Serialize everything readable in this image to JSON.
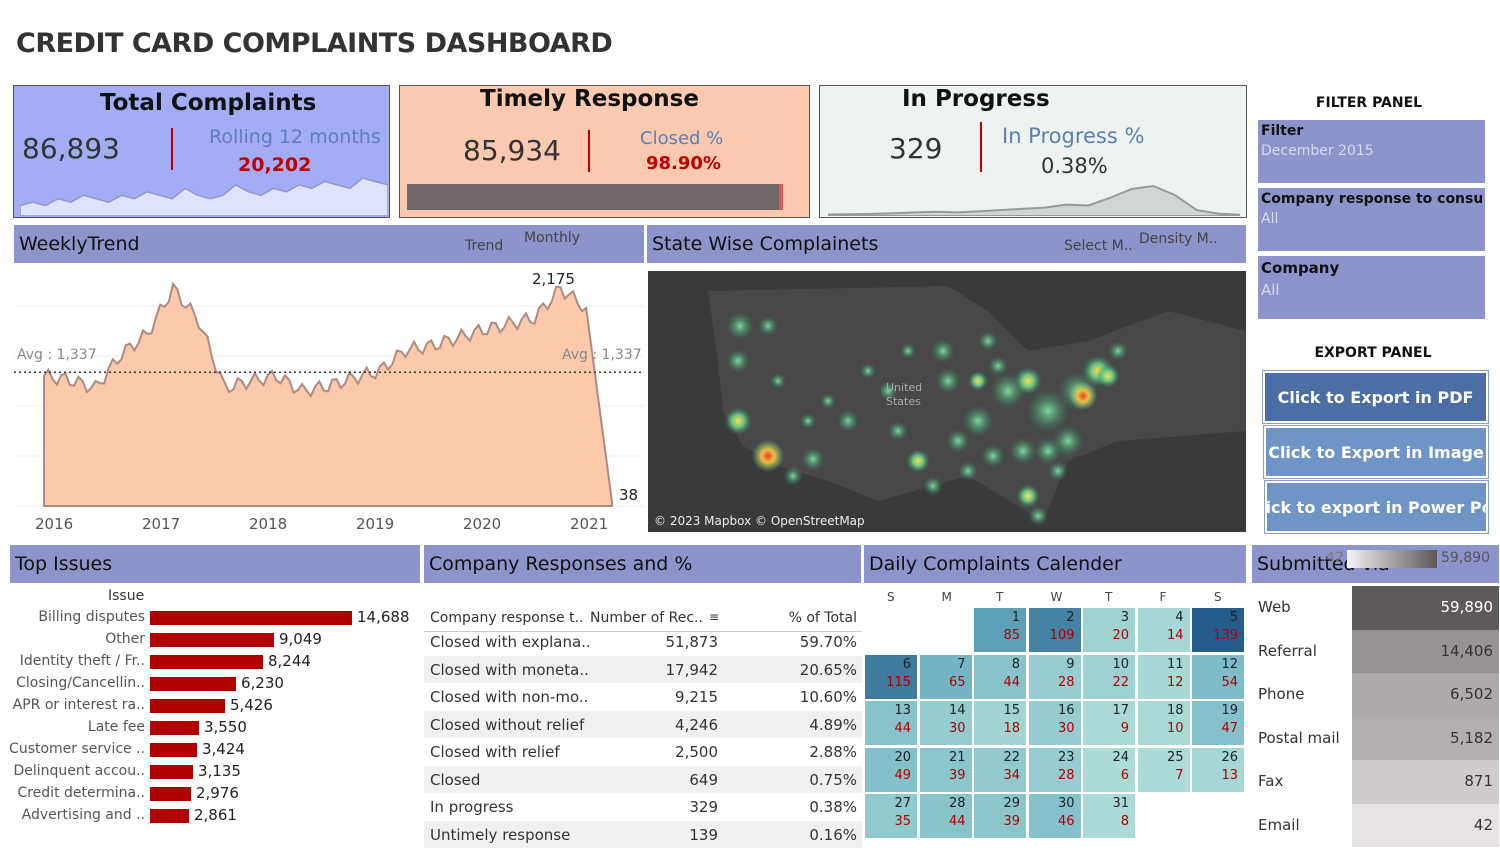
{
  "title": "CREDIT CARD COMPLAINTS DASHBOARD",
  "kpi": {
    "total": {
      "title": "Total Complaints",
      "value": "86,893",
      "sub_label": "Rolling 12 months",
      "sub_value": "20,202"
    },
    "timely": {
      "title": "Timely Response",
      "value": "85,934",
      "sub_label": "Closed %",
      "sub_value": "98.90%",
      "bar_fraction": 0.989
    },
    "progress": {
      "title": "In Progress",
      "value": "329",
      "sub_label": "In Progress %",
      "sub_value": "0.38%"
    }
  },
  "weekly": {
    "header": "WeeklyTrend",
    "trend_label": "Trend",
    "trend_value": "Monthly",
    "avg_left": "Avg : 1,337",
    "avg_right": "Avg : 1,337",
    "peak_label": "2,175",
    "end_label": "38",
    "years": [
      "2016",
      "2017",
      "2018",
      "2019",
      "2020",
      "2021"
    ]
  },
  "state": {
    "header": "State Wise Complainets",
    "select_label": "Select M..",
    "select_value": "Density M..",
    "map_label_1": "United",
    "map_label_2": "States",
    "attribution": "© 2023 Mapbox © OpenStreetMap"
  },
  "filter_panel": {
    "title": "FILTER PANEL",
    "filters": [
      {
        "label": "Filter",
        "value": "December 2015"
      },
      {
        "label": "Company response to consumer",
        "value": "All"
      },
      {
        "label": "Company",
        "value": "All"
      }
    ]
  },
  "export_panel": {
    "title": "EXPORT PANEL",
    "buttons": [
      "Click to Export in PDF",
      "Click to Export in Image",
      "Click to export in Power Po.."
    ]
  },
  "top_issues": {
    "header": "Top Issues",
    "column": "Issue",
    "items": [
      {
        "label": "Billing disputes",
        "value": "14,688",
        "n": 14688
      },
      {
        "label": "Other",
        "value": "9,049",
        "n": 9049
      },
      {
        "label": "Identity theft / Fr..",
        "value": "8,244",
        "n": 8244
      },
      {
        "label": "Closing/Cancellin..",
        "value": "6,230",
        "n": 6230
      },
      {
        "label": "APR or interest ra..",
        "value": "5,426",
        "n": 5426
      },
      {
        "label": "Late fee",
        "value": "3,550",
        "n": 3550
      },
      {
        "label": "Customer service ..",
        "value": "3,424",
        "n": 3424
      },
      {
        "label": "Delinquent accou..",
        "value": "3,135",
        "n": 3135
      },
      {
        "label": "Credit determina..",
        "value": "2,976",
        "n": 2976
      },
      {
        "label": "Advertising and ..",
        "value": "2,861",
        "n": 2861
      }
    ]
  },
  "responses": {
    "header": "Company Responses and %",
    "columns": [
      "Company response t..",
      "Number of Rec..",
      "% of Total"
    ],
    "rows": [
      [
        "Closed with explana..",
        "51,873",
        "59.70%"
      ],
      [
        "Closed with moneta..",
        "17,942",
        "20.65%"
      ],
      [
        "Closed with non-mo..",
        "9,215",
        "10.60%"
      ],
      [
        "Closed without relief",
        "4,246",
        "4.89%"
      ],
      [
        "Closed with relief",
        "2,500",
        "2.88%"
      ],
      [
        "Closed",
        "649",
        "0.75%"
      ],
      [
        "In progress",
        "329",
        "0.38%"
      ],
      [
        "Untimely response",
        "139",
        "0.16%"
      ]
    ]
  },
  "calendar": {
    "header": "Daily Complaints Calender",
    "weekdays": [
      "S",
      "M",
      "T",
      "W",
      "T",
      "F",
      "S"
    ],
    "first_weekday": 2,
    "days": [
      {
        "d": "1",
        "c": "85",
        "n": 85
      },
      {
        "d": "2",
        "c": "109",
        "n": 109
      },
      {
        "d": "3",
        "c": "20",
        "n": 20
      },
      {
        "d": "4",
        "c": "14",
        "n": 14
      },
      {
        "d": "5",
        "c": "139",
        "n": 139
      },
      {
        "d": "6",
        "c": "115",
        "n": 115
      },
      {
        "d": "7",
        "c": "65",
        "n": 65
      },
      {
        "d": "8",
        "c": "44",
        "n": 44
      },
      {
        "d": "9",
        "c": "28",
        "n": 28
      },
      {
        "d": "10",
        "c": "22",
        "n": 22
      },
      {
        "d": "11",
        "c": "12",
        "n": 12
      },
      {
        "d": "12",
        "c": "54",
        "n": 54
      },
      {
        "d": "13",
        "c": "44",
        "n": 44
      },
      {
        "d": "14",
        "c": "30",
        "n": 30
      },
      {
        "d": "15",
        "c": "18",
        "n": 18
      },
      {
        "d": "16",
        "c": "30",
        "n": 30
      },
      {
        "d": "17",
        "c": "9",
        "n": 9
      },
      {
        "d": "18",
        "c": "10",
        "n": 10
      },
      {
        "d": "19",
        "c": "47",
        "n": 47
      },
      {
        "d": "20",
        "c": "49",
        "n": 49
      },
      {
        "d": "21",
        "c": "39",
        "n": 39
      },
      {
        "d": "22",
        "c": "34",
        "n": 34
      },
      {
        "d": "23",
        "c": "28",
        "n": 28
      },
      {
        "d": "24",
        "c": "6",
        "n": 6
      },
      {
        "d": "25",
        "c": "7",
        "n": 7
      },
      {
        "d": "26",
        "c": "13",
        "n": 13
      },
      {
        "d": "27",
        "c": "35",
        "n": 35
      },
      {
        "d": "28",
        "c": "44",
        "n": 44
      },
      {
        "d": "29",
        "c": "39",
        "n": 39
      },
      {
        "d": "30",
        "c": "46",
        "n": 46
      },
      {
        "d": "31",
        "c": "8",
        "n": 8
      }
    ]
  },
  "submitted": {
    "header": "Submitted via",
    "legend_min": "42",
    "legend_max": "59,890",
    "rows": [
      {
        "label": "Web",
        "value": "59,890",
        "n": 59890
      },
      {
        "label": "Referral",
        "value": "14,406",
        "n": 14406
      },
      {
        "label": "Phone",
        "value": "6,502",
        "n": 6502
      },
      {
        "label": "Postal mail",
        "value": "5,182",
        "n": 5182
      },
      {
        "label": "Fax",
        "value": "871",
        "n": 871
      },
      {
        "label": "Email",
        "value": "42",
        "n": 42
      }
    ]
  },
  "chart_data": [
    {
      "type": "area",
      "x": [
        "2016",
        "2017",
        "2018",
        "2019",
        "2020",
        "2021"
      ],
      "series": [
        {
          "values": [
            1300,
            1260,
            1180,
            1520,
            1720,
            2175,
            1850,
            1180,
            1250,
            1300,
            1150,
            1200,
            1280,
            1350,
            1560,
            1600,
            1680,
            1760,
            1820,
            1880,
            2175,
            1980,
            38
          ]
        }
      ],
      "avg": 1337,
      "ylim": [
        0,
        2400
      ]
    },
    {
      "type": "area",
      "series": [
        {
          "values": [
            5,
            6,
            7,
            9,
            12,
            14,
            12,
            16,
            20,
            24,
            28,
            38,
            35,
            60,
            90,
            100,
            70,
            20,
            8,
            4
          ]
        }
      ]
    },
    {
      "type": "area",
      "series": [
        {
          "values": [
            3,
            4,
            3,
            5,
            4,
            6,
            5,
            4,
            6,
            5,
            7,
            6,
            5,
            8,
            6,
            5,
            6,
            9,
            7,
            6,
            8,
            7,
            9,
            8,
            10,
            9,
            8,
            11,
            10,
            9
          ]
        }
      ]
    }
  ]
}
